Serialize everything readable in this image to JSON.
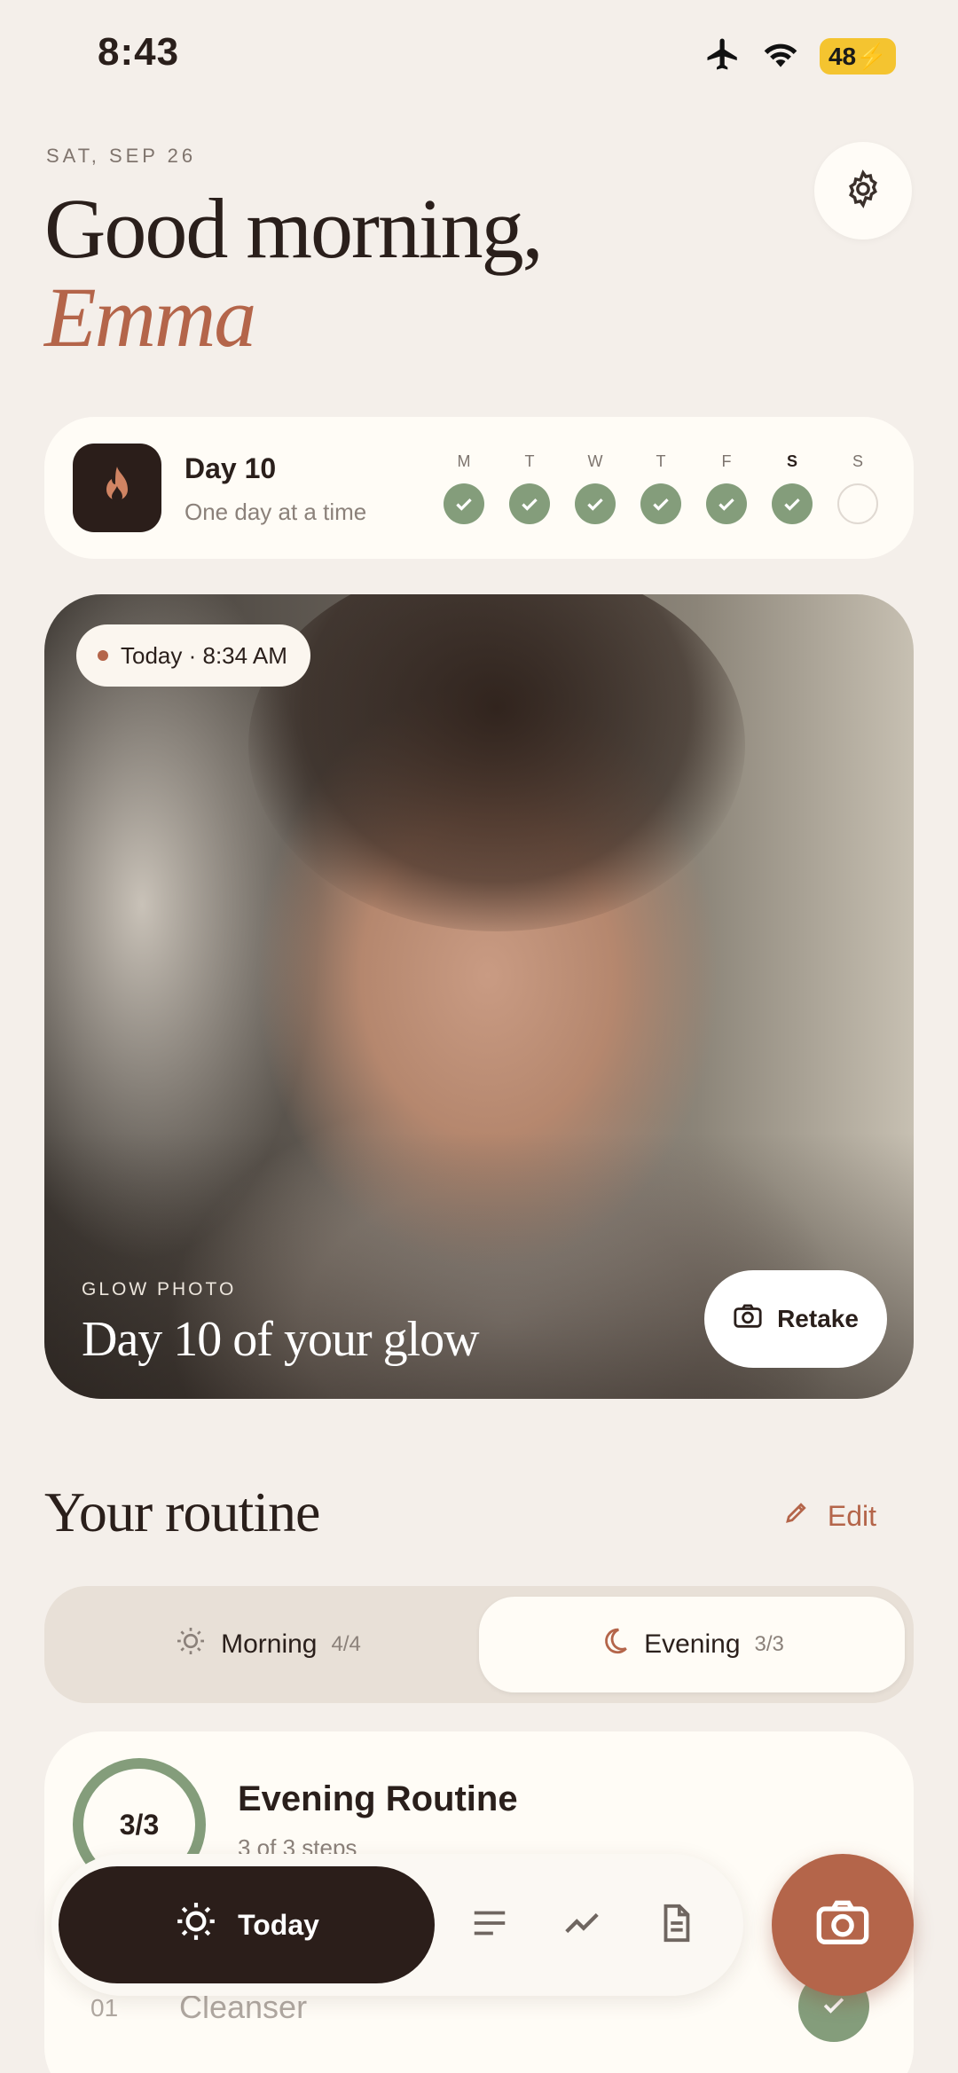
{
  "status_bar": {
    "time": "8:43",
    "battery": "48"
  },
  "header": {
    "date": "SAT, SEP 26",
    "greeting": "Good morning,",
    "name": "Emma"
  },
  "streak": {
    "title": "Day 10",
    "subtitle": "One day at a time",
    "days": [
      {
        "letter": "M",
        "done": true
      },
      {
        "letter": "T",
        "done": true
      },
      {
        "letter": "W",
        "done": true
      },
      {
        "letter": "T",
        "done": true
      },
      {
        "letter": "F",
        "done": true
      },
      {
        "letter": "S",
        "done": true
      },
      {
        "letter": "S",
        "done": false
      }
    ]
  },
  "photo": {
    "timestamp": "Today · 8:34 AM",
    "label": "GLOW PHOTO",
    "caption": "Day 10 of your glow",
    "retake_label": "Retake"
  },
  "routine": {
    "title": "Your routine",
    "edit_label": "Edit",
    "tabs": [
      {
        "label": "Morning",
        "count": "4/4",
        "icon": "sun-icon",
        "selected": false
      },
      {
        "label": "Evening",
        "count": "3/3",
        "icon": "moon-icon",
        "selected": true
      }
    ],
    "card": {
      "progress": "3/3",
      "title": "Evening Routine",
      "subtitle": "3 of 3 steps",
      "steps": [
        {
          "num": "01",
          "name": "Cleanser",
          "done": true
        }
      ]
    }
  },
  "nav": {
    "today_label": "Today",
    "items": [
      "list-icon",
      "trend-icon",
      "document-icon"
    ],
    "fab_icon": "camera-icon"
  },
  "colors": {
    "accent": "#b4654a",
    "success": "#849d7b",
    "dark": "#2b1e1a",
    "background": "#f4efea"
  }
}
